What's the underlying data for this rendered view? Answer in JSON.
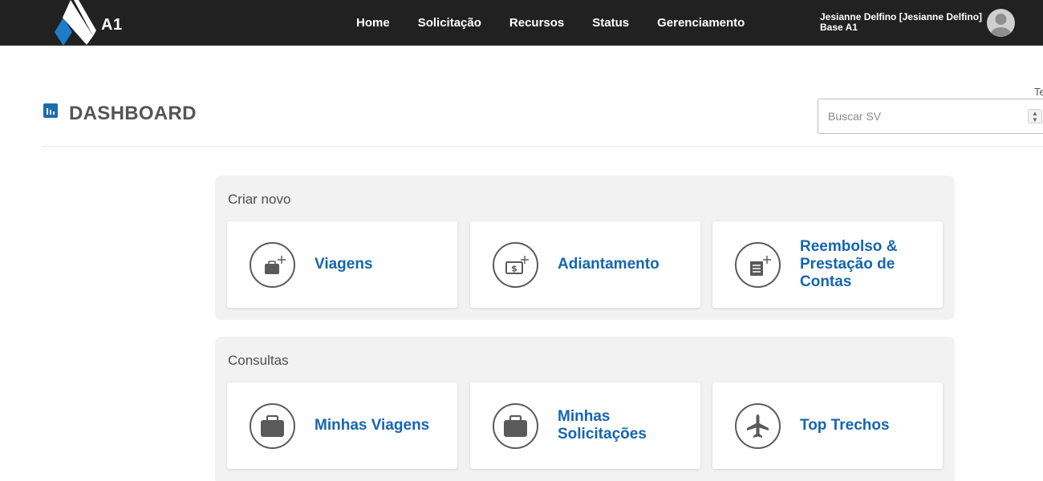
{
  "brand": {
    "name": "A1"
  },
  "nav": {
    "items": [
      "Home",
      "Solicitação",
      "Recursos",
      "Status",
      "Gerenciamento"
    ]
  },
  "user": {
    "name": "Jesianne Delfino [Jesianne Delfino]",
    "base": "Base A1"
  },
  "header": {
    "title": "DASHBOARD",
    "side_label": "Te",
    "search_placeholder": "Buscar SV"
  },
  "sections": {
    "criar": {
      "title": "Criar novo",
      "cards": [
        {
          "label": "Viagens",
          "icon": "briefcase-plus-icon"
        },
        {
          "label": "Adiantamento",
          "icon": "money-plus-icon"
        },
        {
          "label": "Reembolso & Prestação de Contas",
          "icon": "receipt-plus-icon"
        }
      ]
    },
    "consultas": {
      "title": "Consultas",
      "cards": [
        {
          "label": "Minhas Viagens",
          "icon": "briefcase-icon"
        },
        {
          "label": "Minhas Solicitações",
          "icon": "briefcase-icon"
        },
        {
          "label": "Top Trechos",
          "icon": "airplane-icon"
        }
      ]
    }
  },
  "colors": {
    "topbar": "#212121",
    "accent": "#1565b0",
    "panel": "#f2f2f2"
  }
}
